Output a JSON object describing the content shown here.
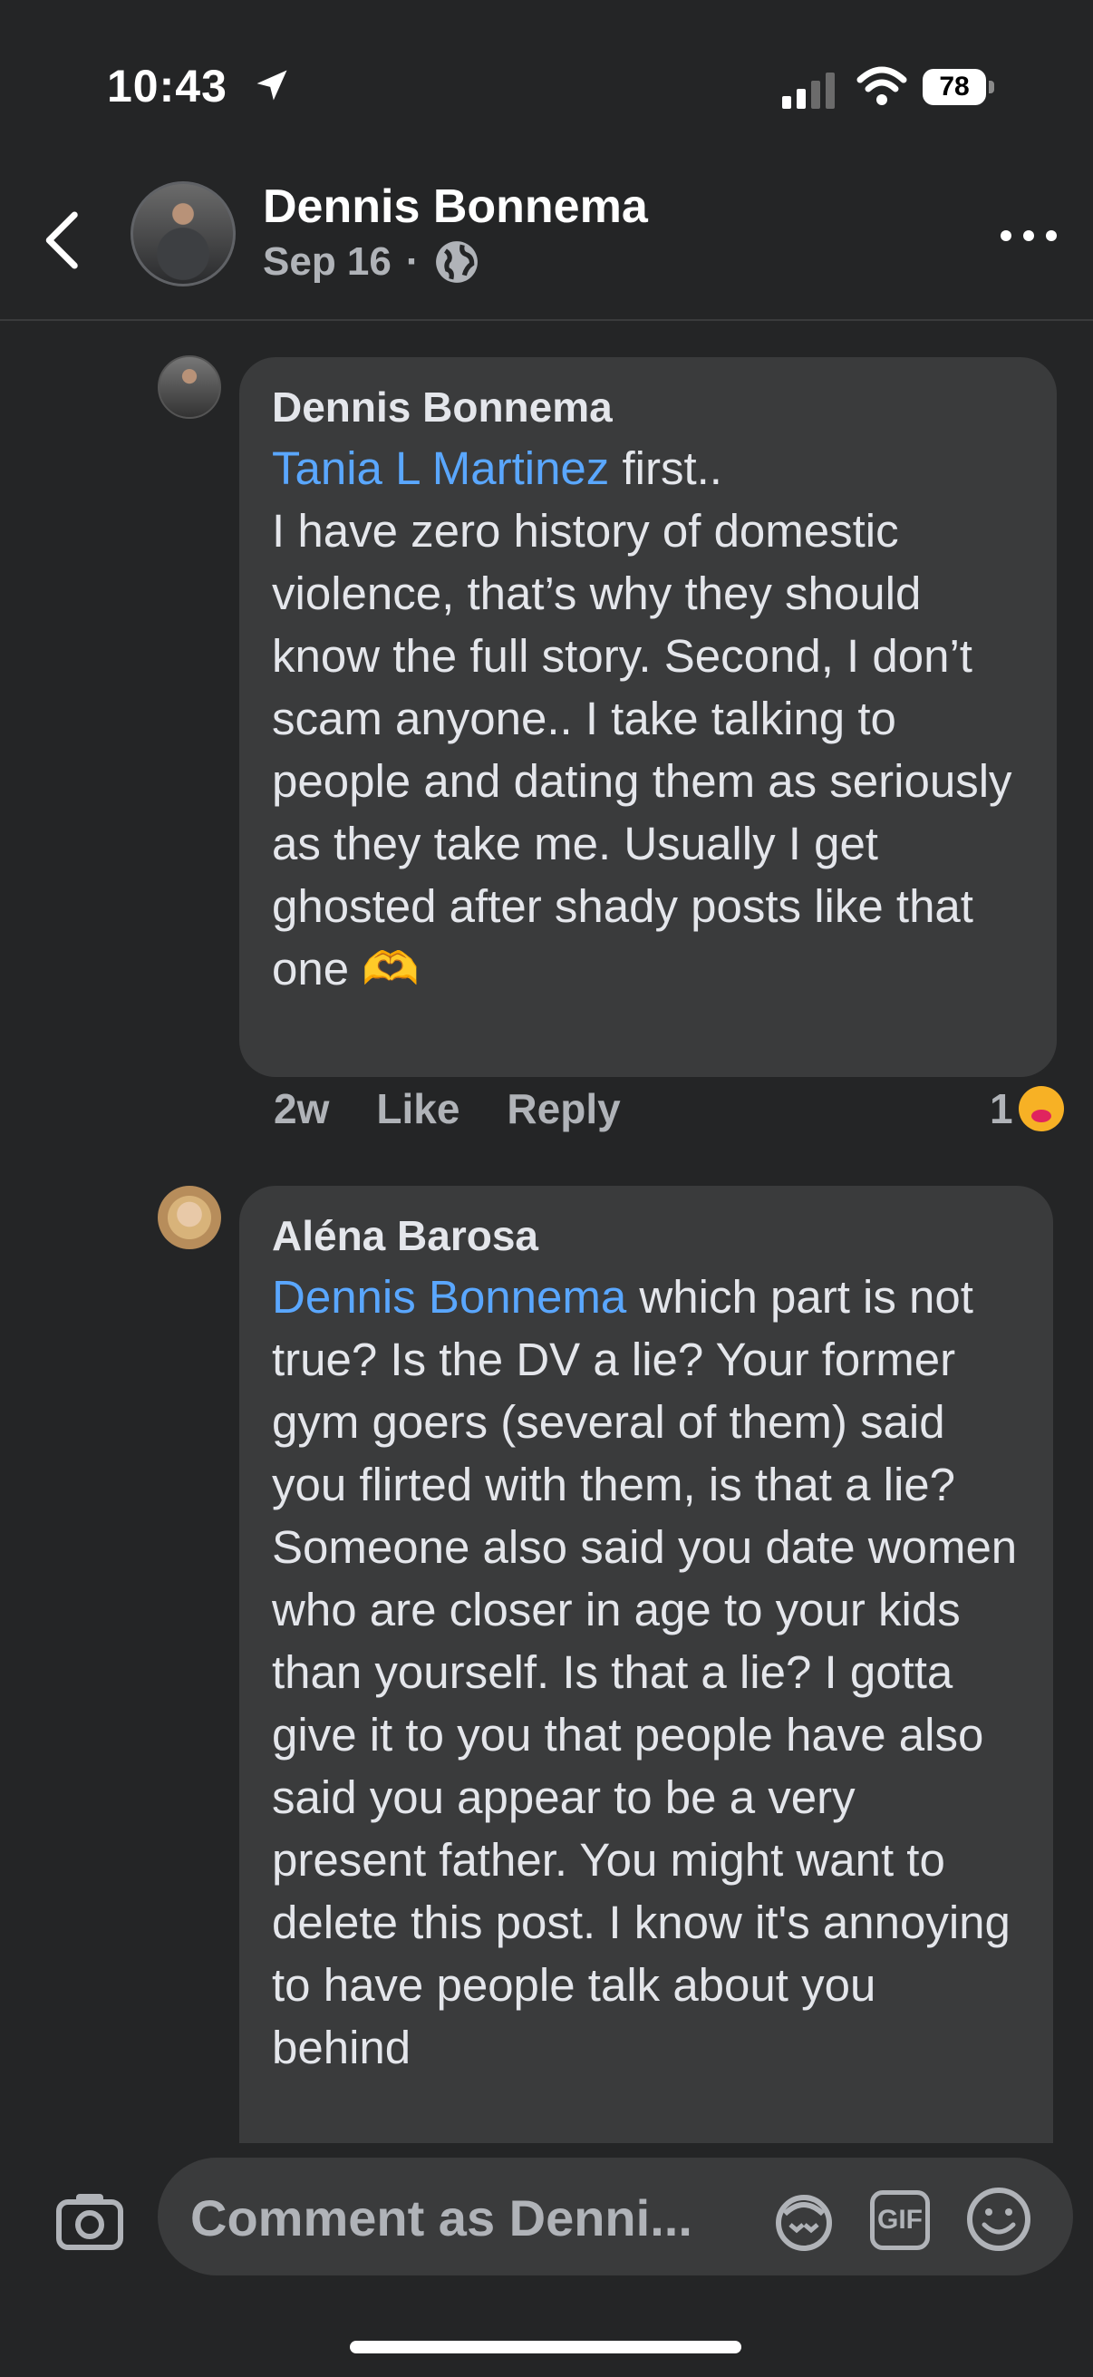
{
  "status_bar": {
    "time": "10:43",
    "battery": "78"
  },
  "header": {
    "name": "Dennis Bonnema",
    "date": "Sep 16",
    "separator": "·"
  },
  "comments": [
    {
      "author": "Dennis Bonnema",
      "mention": "Tania L Martinez",
      "text": " first..\nI have zero history of domestic violence, that’s why they should know the full story. Second, I don’t scam anyone.. I take talking to people and dating them as seriously as they take me. Usually I get ghosted after shady posts like that one 🫶",
      "time": "2w",
      "like_label": "Like",
      "reply_label": "Reply",
      "reaction_count": "1"
    },
    {
      "author": "Aléna Barosa",
      "mention": "Dennis Bonnema",
      "text": " which part is not true? Is the DV a lie? Your former gym goers (several of them) said you flirted with them, is that a lie? Someone also said you date women who are closer in age to your kids than yourself. Is that a lie? I gotta give it to you that people have also said you appear to be a very present father. You might want to delete this post. I know it's annoying to have people talk about you behind"
    }
  ],
  "composer": {
    "placeholder": "Comment as Denni...",
    "gif_label": "GIF"
  }
}
